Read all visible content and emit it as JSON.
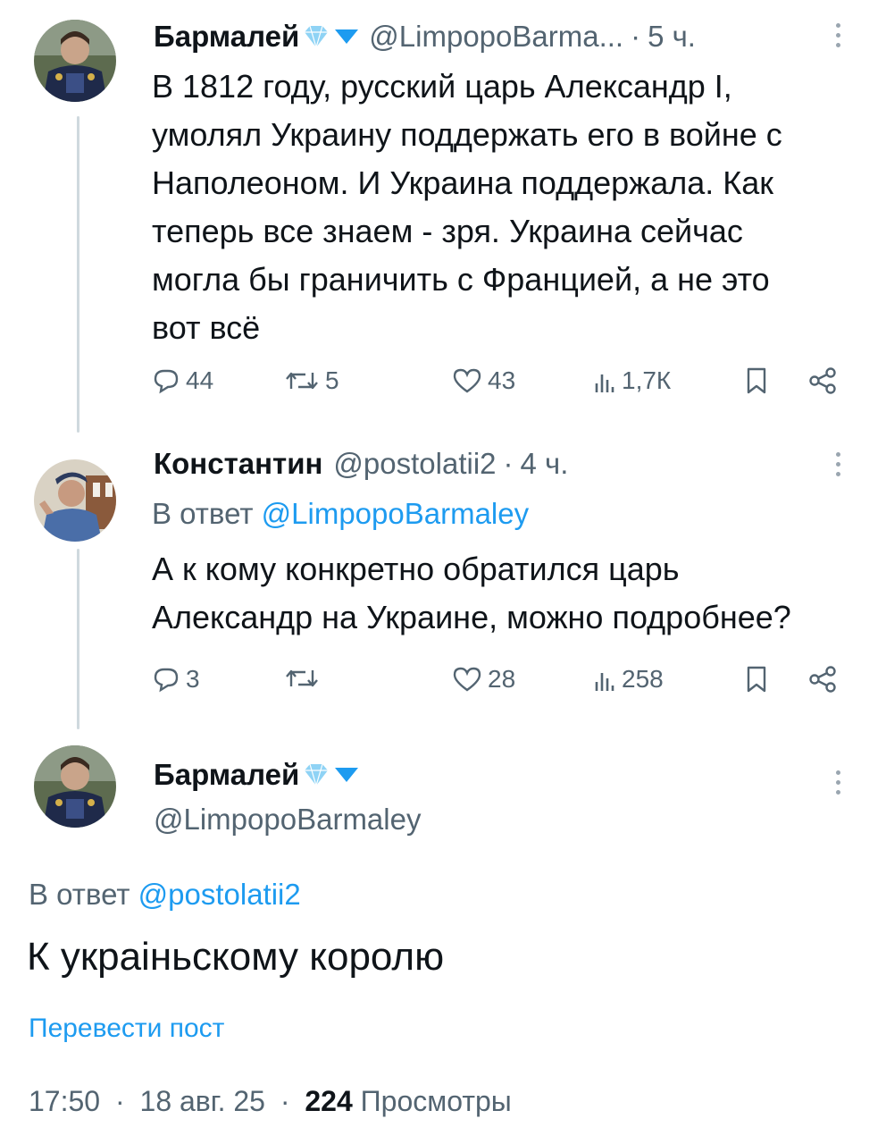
{
  "tweet1": {
    "name": "Бармалей",
    "handle": "@LimpopoBarma...",
    "separator": "·",
    "time": "5 ч.",
    "lines": [
      "В 1812 году, русский царь Александр I,",
      "умолял Украину поддержать его в войне с",
      "Наполеоном. И Украина поддержала. Как",
      "теперь все знаем - зря. Украина сейчас",
      "могла бы граничить с Францией, а не это",
      "вот всё"
    ],
    "stats": {
      "replies": "44",
      "reposts": "5",
      "likes": "43",
      "views": "1,7К"
    }
  },
  "tweet2": {
    "name": "Константин",
    "handle": "@postolatii2",
    "separator": "·",
    "time": "4 ч.",
    "reply_prefix": "В ответ",
    "reply_handle": "@LimpopoBarmaley",
    "lines": [
      "А к кому конкретно обратился царь",
      "Александр на Украине, можно подробнее?"
    ],
    "stats": {
      "replies": "3",
      "reposts": "",
      "likes": "28",
      "views": "258"
    }
  },
  "tweet3": {
    "name": "Бармалей",
    "handle": "@LimpopoBarmaley",
    "reply_prefix": "В ответ",
    "reply_handle": "@postolatii2",
    "text": "К украіньскому королю",
    "translate": "Перевести пост",
    "time": "17:50",
    "separator": "·",
    "date": "18 авг. 25",
    "views_count": "224",
    "views_label": "Просмотры"
  },
  "icons": {
    "reply": "reply-icon",
    "repost": "repost-icon",
    "like": "heart-icon",
    "views": "views-icon",
    "bookmark": "bookmark-icon",
    "share": "share-icon",
    "more": "more-icon",
    "premium": "diamond-badge-icon",
    "verified": "verified-badge-icon"
  },
  "colors": {
    "accent": "#1d9bf0",
    "muted": "#536471",
    "text": "#0f1419",
    "line": "#cfd9de"
  }
}
